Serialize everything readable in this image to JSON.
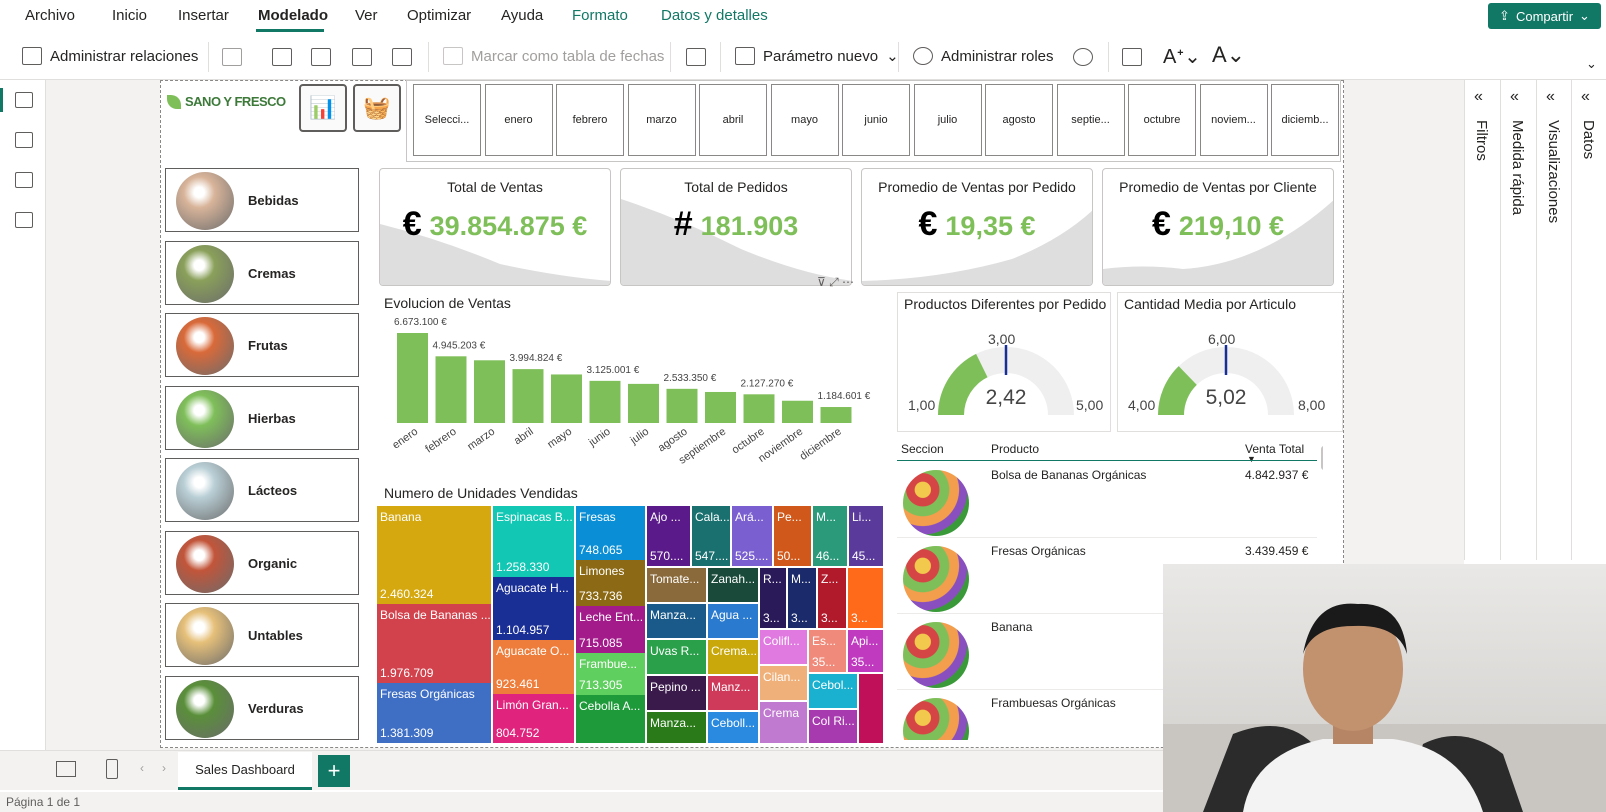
{
  "menu": {
    "items": [
      "Archivo",
      "Inicio",
      "Insertar",
      "Modelado",
      "Ver",
      "Optimizar",
      "Ayuda"
    ],
    "active": "Modelado",
    "contextual": [
      "Formato",
      "Datos y detalles"
    ],
    "share_label": "Compartir"
  },
  "ribbon": {
    "manage_relations": "Administrar relaciones",
    "mark_date_table": "Marcar como tabla de fechas",
    "new_parameter": "Parámetro nuevo",
    "manage_roles": "Administrar roles"
  },
  "logo": {
    "text": "SANO Y FRESCO"
  },
  "months": [
    "Selecci...",
    "enero",
    "febrero",
    "marzo",
    "abril",
    "mayo",
    "junio",
    "julio",
    "agosto",
    "septie...",
    "octubre",
    "noviem...",
    "diciemb..."
  ],
  "categories": [
    {
      "label": "Bebidas",
      "color": "#d8b49a"
    },
    {
      "label": "Cremas",
      "color": "#8aa05a"
    },
    {
      "label": "Frutas",
      "color": "#d96a3a"
    },
    {
      "label": "Hierbas",
      "color": "#7fbf5a"
    },
    {
      "label": "Lácteos",
      "color": "#b9cfd6"
    },
    {
      "label": "Organic",
      "color": "#c2553a"
    },
    {
      "label": "Untables",
      "color": "#e6c07a"
    },
    {
      "label": "Verduras",
      "color": "#5a8f3a"
    }
  ],
  "kpis": [
    {
      "title": "Total de Ventas",
      "symbol": "€",
      "value": "39.854.875 €"
    },
    {
      "title": "Total de Pedidos",
      "symbol": "#",
      "value": "181.903"
    },
    {
      "title": "Promedio de Ventas por Pedido",
      "symbol": "€",
      "value": "19,35 €"
    },
    {
      "title": "Promedio de Ventas por Cliente",
      "symbol": "€",
      "value": "219,10 €"
    }
  ],
  "chart_data": {
    "type": "bar",
    "title": "Evolucion de Ventas",
    "categories": [
      "enero",
      "febrero",
      "marzo",
      "abril",
      "mayo",
      "junio",
      "julio",
      "agosto",
      "septiembre",
      "octubre",
      "noviembre",
      "diciembre"
    ],
    "values": [
      6673100,
      4945203,
      4650000,
      3994824,
      3600000,
      3125001,
      2900000,
      2533350,
      2300000,
      2127270,
      1650000,
      1184601
    ],
    "data_labels": [
      "6.673.100 €",
      "4.945.203 €",
      "",
      "3.994.824 €",
      "",
      "3.125.001 €",
      "",
      "2.533.350 €",
      "",
      "2.127.270 €",
      "",
      "1.184.601 €"
    ],
    "color": "#7fbf5a"
  },
  "gauges": [
    {
      "title": "Productos Diferentes por Pedido",
      "value": "2,42",
      "min": "1,00",
      "max": "5,00",
      "target": "3,00",
      "fraction": 0.355,
      "target_fraction": 0.5
    },
    {
      "title": "Cantidad Media por Articulo",
      "value": "5,02",
      "min": "4,00",
      "max": "8,00",
      "target": "6,00",
      "fraction": 0.255,
      "target_fraction": 0.5
    }
  ],
  "treemap": {
    "title": "Numero de Unidades Vendidas",
    "tiles": [
      {
        "name": "Banana",
        "value": "2.460.324",
        "color": "#d4a80e"
      },
      {
        "name": "Bolsa de Bananas ...",
        "value": "1.976.709",
        "color": "#d2424c"
      },
      {
        "name": "Fresas Orgánicas",
        "value": "1.381.309",
        "color": "#3f6fc5"
      },
      {
        "name": "Espinacas B...",
        "value": "1.258.330",
        "color": "#12c7b3"
      },
      {
        "name": "Aguacate H...",
        "value": "1.104.957",
        "color": "#1a2f96"
      },
      {
        "name": "Aguacate O...",
        "value": "923.461",
        "color": "#ee7d3b"
      },
      {
        "name": "Limón Gran...",
        "value": "804.752",
        "color": "#e0237c"
      },
      {
        "name": "Fresas",
        "value": "748.065",
        "color": "#0a8fd6"
      },
      {
        "name": "Limones",
        "value": "733.736",
        "color": "#8c6a15"
      },
      {
        "name": "Leche Ent...",
        "value": "715.085",
        "color": "#a31a8a"
      },
      {
        "name": "Frambue...",
        "value": "713.305",
        "color": "#5fcf5f"
      },
      {
        "name": "Cebolla A...",
        "value": "",
        "color": "#1f9a3a"
      },
      {
        "name": "Ajo ...",
        "value": "570....",
        "color": "#5a1a8a"
      },
      {
        "name": "Cala...",
        "value": "547....",
        "color": "#1a6f6f"
      },
      {
        "name": "Ará...",
        "value": "525....",
        "color": "#7a5fd0"
      },
      {
        "name": "Pe...",
        "value": "50...",
        "color": "#d0581a"
      },
      {
        "name": "M...",
        "value": "46...",
        "color": "#2a9a7a"
      },
      {
        "name": "Li...",
        "value": "45...",
        "color": "#5a3a9a"
      },
      {
        "name": "Tomate...",
        "value": "",
        "color": "#8a6a3a"
      },
      {
        "name": "Zanah...",
        "value": "",
        "color": "#1a4a3a"
      },
      {
        "name": "R...",
        "value": "3...",
        "color": "#2a1a5a"
      },
      {
        "name": "M...",
        "value": "3...",
        "color": "#1a2a6a"
      },
      {
        "name": "Z...",
        "value": "3...",
        "color": "#b01a2a"
      },
      {
        "name": "",
        "value": "3...",
        "color": "#ff6a1a"
      },
      {
        "name": "Manza...",
        "value": "",
        "color": "#1a5a8a"
      },
      {
        "name": "Agua ...",
        "value": "",
        "color": "#2a7ad0"
      },
      {
        "name": "Colifl...",
        "value": "",
        "color": "#e07ae0"
      },
      {
        "name": "Es...",
        "value": "35...",
        "color": "#f08a7a"
      },
      {
        "name": "Api...",
        "value": "35...",
        "color": "#c03ac0"
      },
      {
        "name": "Uvas R...",
        "value": "",
        "color": "#2aa04a"
      },
      {
        "name": "Crema...",
        "value": "",
        "color": "#c8a80a"
      },
      {
        "name": "Cilan...",
        "value": "",
        "color": "#f0b07a"
      },
      {
        "name": "Cebol...",
        "value": "",
        "color": "#1ab0d0"
      },
      {
        "name": "Pepino ...",
        "value": "",
        "color": "#3a1a4a"
      },
      {
        "name": "Manz...",
        "value": "",
        "color": "#d03a5a"
      },
      {
        "name": "Crema",
        "value": "",
        "color": "#c07ad0"
      },
      {
        "name": "Col Ri...",
        "value": "",
        "color": "#a83ab0"
      },
      {
        "name": "Manza...",
        "value": "",
        "color": "#2a7a1a"
      },
      {
        "name": "Ceboll...",
        "value": "",
        "color": "#2a8ae0"
      },
      {
        "name": "",
        "value": "",
        "color": "#c0105a"
      }
    ]
  },
  "table": {
    "headers": [
      "Seccion",
      "Producto",
      "Venta Total"
    ],
    "rows": [
      {
        "product": "Bolsa de Bananas Orgánicas",
        "value": "4.842.937 €"
      },
      {
        "product": "Fresas Orgánicas",
        "value": "3.439.459 €"
      },
      {
        "product": "Banana",
        "value": ""
      },
      {
        "product": "Frambuesas Orgánicas",
        "value": ""
      }
    ]
  },
  "panes": [
    "Filtros",
    "Medida rápida",
    "Visualizaciones",
    "Datos"
  ],
  "bottom": {
    "tab": "Sales Dashboard",
    "add": "+",
    "status": "Página 1 de 1"
  }
}
